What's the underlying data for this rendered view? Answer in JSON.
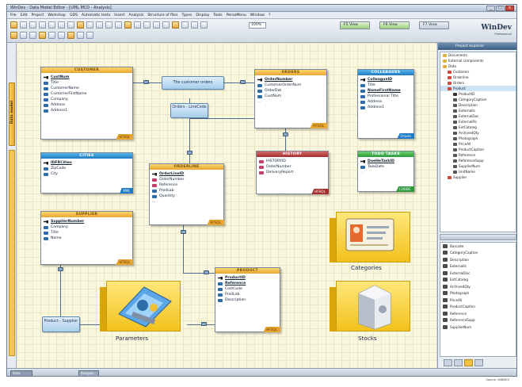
{
  "window": {
    "title": "WinDev - Data Model Editor - [UML MCD - Analysis]",
    "buttons": [
      "_",
      "□",
      "×"
    ]
  },
  "menu": [
    "File",
    "Edit",
    "Project",
    "Workshop",
    "GDS",
    "Automatic tests",
    "Insert",
    "Analysis",
    "Structure of files",
    "Types",
    "Display",
    "Tools",
    "PersoMenu",
    "Window",
    "?"
  ],
  "toolbar": {
    "zoom": "100%",
    "modes": [
      "F5 View",
      "F6 View",
      "F7 View"
    ],
    "brand": "WinDev",
    "brand_sub": "Professional"
  },
  "left_tab": "Data model",
  "tables": {
    "customer": {
      "title": "CUSTOMER",
      "rows": [
        "CustNum",
        "Title",
        "CustomerName",
        "CustomerFirstName",
        "Company",
        "Address",
        "Address1"
      ],
      "foot": "HFSQL"
    },
    "orders": {
      "title": "ORDERS",
      "rows": [
        "OrderNumber",
        "CustomerOrderNum",
        "OrderDat",
        "CustNum",
        "..."
      ],
      "foot": "HFSQL"
    },
    "colleagues": {
      "title": "COLLEAGUES",
      "rows": [
        "ColleagueID",
        "Title",
        "NameFirstName",
        "Professional Title",
        "Address",
        "Address1"
      ],
      "foot": "Oracle"
    },
    "history": {
      "title": "HISTORY",
      "rows": [
        "HISTORYID",
        "OrderNumber",
        "DeliveryReport"
      ],
      "foot": "HFSQL"
    },
    "todo": {
      "title": "TODO TASKS",
      "rows": [
        "DoeHeTaskID",
        "TaskDate",
        "..."
      ],
      "foot": "CODBC"
    },
    "cities": {
      "title": "CITIES",
      "rows": [
        "IDFRCities",
        "ZipCode",
        "City"
      ],
      "foot": "XML"
    },
    "orderline": {
      "title": "ORDERLINE",
      "rows": [
        "OrderLineID",
        "OrderNumber",
        "Reference",
        "ProdLab",
        "Quantity",
        "..."
      ],
      "foot": "HFSQL"
    },
    "supplier": {
      "title": "SUPPLIER",
      "rows": [
        "SupplierNumber",
        "Company",
        "Title",
        "Name",
        "..."
      ],
      "foot": "HFSQL"
    },
    "product": {
      "title": "PRODUCT",
      "rows": [
        "ProductID",
        "Reference",
        "CostCode",
        "ProdLab",
        "Description",
        "..."
      ],
      "foot": "HFSQL"
    }
  },
  "queries": {
    "customer_orders": "The customer orders",
    "orders_linecode": "Orders - LineCode",
    "product_supplier": "Product - Supplier"
  },
  "assets": {
    "categories": "Categories",
    "parameters": "Parameters",
    "stocks": "Stocks"
  },
  "right_panel": {
    "title": "Project explorer",
    "tree": [
      "Documents",
      "External components",
      "Data",
      "Customer",
      "Orderline",
      "Orders",
      "Product",
      "ProductID",
      "CategoryCaption",
      "Description",
      "ExternalIs",
      "ExternalDoc",
      "ExternalPic",
      "ExtCatalog",
      "ArchivedQty",
      "Photograph",
      "PriceAll",
      "ProductCaption",
      "Reference",
      "ReferenceSupp",
      "SupplierNum",
      "UnitName",
      "Supplier"
    ],
    "list": [
      "Barcode",
      "CategoryCaption",
      "Description",
      "ExternalIs",
      "ExternalDoc",
      "ExtCatalog",
      "ArchivedQty",
      "Photograph",
      "PriceAll",
      "ProductCaption",
      "Reference",
      "ReferenceSupp",
      "SupplierNum"
    ]
  },
  "status": {
    "left": "Data",
    "mid": "Analysis",
    "right": "Source: WINDEV"
  },
  "colors": {
    "accent_yellow": "#f2c21c",
    "table_blue": "#1f7cc4",
    "table_red": "#a52f2f",
    "table_green": "#2c9a3b",
    "canvas": "#faf7df"
  }
}
